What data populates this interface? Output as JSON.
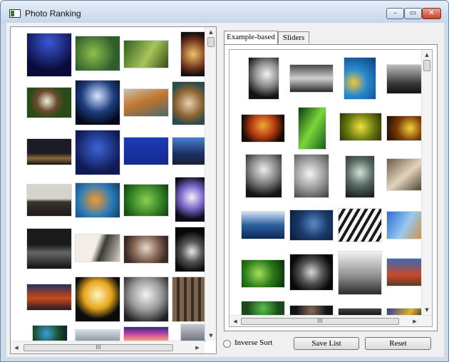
{
  "window": {
    "title": "Photo Ranking"
  },
  "caption_buttons": {
    "minimize": "–",
    "maximize": "▭",
    "close": "✕"
  },
  "tabs": [
    {
      "label": "Example-based"
    },
    {
      "label": "Sliders"
    }
  ],
  "scrollbar": {
    "up": "▲",
    "down": "▼",
    "left": "◀",
    "right": "▶",
    "grip": "III"
  },
  "controls": {
    "inverse_sort_label": "Inverse Sort",
    "save_label": "Save List",
    "reset_label": "Reset"
  },
  "left_photos": [
    "city-night-water",
    "dragonfly",
    "wheat-grass",
    "ferris-wheel",
    "eagle",
    "capitol-night",
    "tiger-water",
    "clock",
    "city-skyline-dusk",
    "cyclist-silhouette",
    "sky-writing",
    "city-bay-night",
    "castle-silhouette",
    "goldfish",
    "green-leaves",
    "white-flower",
    "city-lights",
    "pendulum-clock",
    "old-woman",
    "dark-flower",
    "golden-gate-bridge",
    "flower-glass",
    "astronaut",
    "building-facade",
    "earth-satellite",
    "sneaker",
    "sunset-sky",
    "stone-sculpture"
  ],
  "right_photos": [
    "bw-hand-shadow",
    "bw-pier-water",
    "blue-yellow-fish",
    "bw-hills",
    "man-silhouette-sunset",
    "green-abstract",
    "yellow-flower-blur",
    "yellow-fire-lights",
    "bw-woman-portrait",
    "bw-children-faces",
    "bw-doorway-figure",
    "hands-stones",
    "blue-sphere-pattern",
    "blue-sky-dish",
    "bw-curves",
    "blue-stripes",
    "green-lizard",
    "bw-hand-closeup",
    "bw-fog-bridge",
    "red-barn-sky",
    "green-bubbles",
    "dark-portrait",
    "dark-figure",
    "yellow-blue-wave"
  ]
}
